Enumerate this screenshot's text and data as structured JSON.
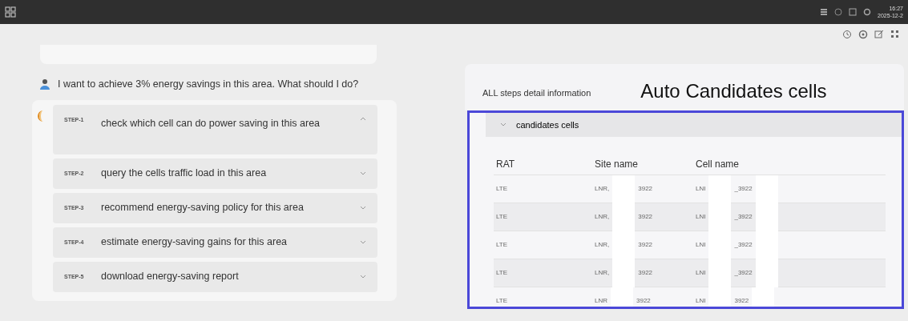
{
  "top_bar": {
    "time": "16:27",
    "date": "2025-12-2"
  },
  "user_message": "I want to achieve 3% energy savings in this area. What should I do?",
  "steps": [
    {
      "label": "STEP-1",
      "text": "check which cell can do power saving in this area",
      "expanded": true
    },
    {
      "label": "STEP-2",
      "text": "query the cells traffic load in this area",
      "expanded": false
    },
    {
      "label": "STEP-3",
      "text": "recommend energy-saving policy for this area",
      "expanded": false
    },
    {
      "label": "STEP-4",
      "text": "estimate energy-saving gains for this area",
      "expanded": false
    },
    {
      "label": "STEP-5",
      "text": "download energy-saving report",
      "expanded": false
    }
  ],
  "detail_panel": {
    "title": "ALL steps detail information",
    "annotation": "Auto Candidates cells",
    "section": {
      "title": "candidates cells",
      "expanded": true,
      "columns": [
        "RAT",
        "Site name",
        "Cell name"
      ],
      "rows": [
        {
          "rat": "LTE",
          "site_start": "LNR,",
          "site_end": "3922",
          "cell_start": "LNI",
          "cell_end": "_3922"
        },
        {
          "rat": "LTE",
          "site_start": "LNR,",
          "site_end": "3922",
          "cell_start": "LNI",
          "cell_end": "_3922"
        },
        {
          "rat": "LTE",
          "site_start": "LNR,",
          "site_end": "3922",
          "cell_start": "LNI",
          "cell_end": "_3922"
        },
        {
          "rat": "LTE",
          "site_start": "LNR,",
          "site_end": "3922",
          "cell_start": "LNI",
          "cell_end": "_3922"
        },
        {
          "rat": "LTE",
          "site_start": "LNR",
          "site_end": "3922",
          "cell_start": "LNI",
          "cell_end": "3922"
        }
      ]
    }
  }
}
